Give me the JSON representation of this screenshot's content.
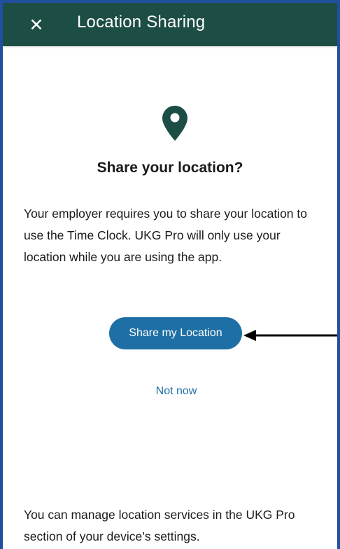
{
  "header": {
    "close_label": "✕",
    "title": "Location Sharing"
  },
  "icons": {
    "close": "close-icon",
    "pin": "location-pin-icon",
    "arrow": "arrow-left-icon"
  },
  "colors": {
    "header_bg": "#1d4e45",
    "pin": "#1d4e45",
    "accent": "#1e6fa5",
    "frame_border": "#1f4f9e"
  },
  "dialog": {
    "title": "Share your location?",
    "body": "Your employer requires you to share your location to use the Time Clock. UKG Pro will only use your location while you are using the app.",
    "share_button_label": "Share my Location",
    "not_now_label": "Not now",
    "footer": "You can manage location services in the UKG Pro section of your device’s settings."
  }
}
